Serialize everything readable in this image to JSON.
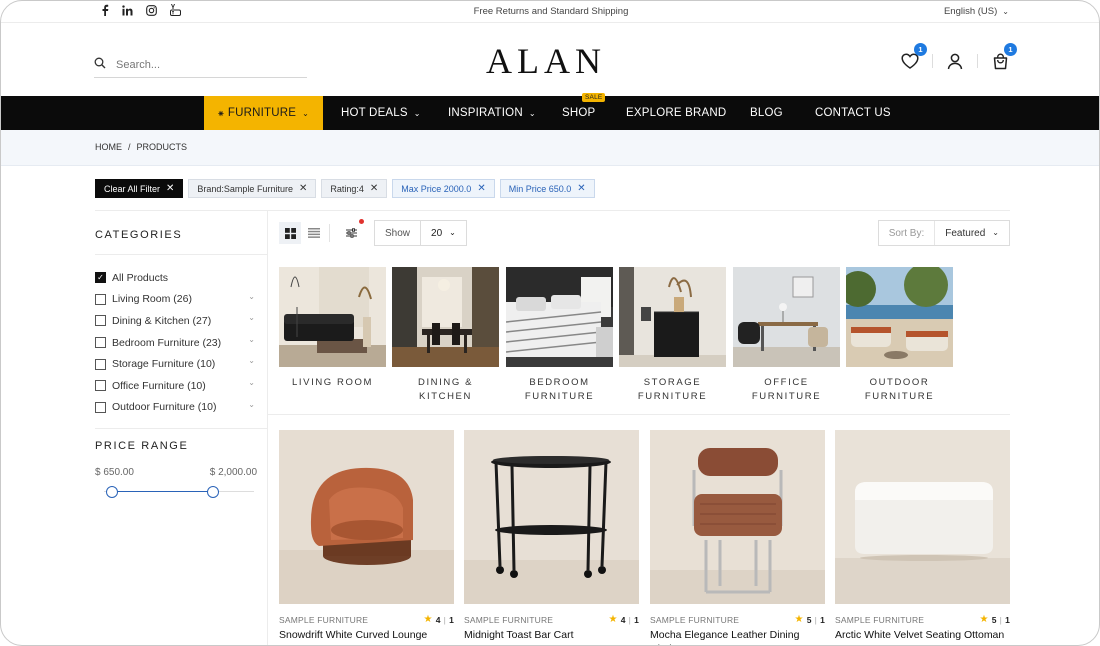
{
  "topbar": {
    "promo": "Free Returns and Standard Shipping",
    "language": "English (US)",
    "socials": [
      "facebook-icon",
      "linkedin-icon",
      "instagram-icon",
      "youtube-icon"
    ]
  },
  "header": {
    "logo": "ALAN",
    "search_placeholder": "Search...",
    "wishlist_count": "1",
    "cart_count": "1"
  },
  "nav": {
    "items": [
      {
        "label": "FURNITURE",
        "icon": "snowflake-icon",
        "dropdown": true,
        "active": true
      },
      {
        "label": "HOT DEALS",
        "dropdown": true
      },
      {
        "label": "INSPIRATION",
        "dropdown": true
      },
      {
        "label": "SHOP",
        "tag": "SALE"
      },
      {
        "label": "EXPLORE BRAND"
      },
      {
        "label": "BLOG"
      },
      {
        "label": "CONTACT US"
      }
    ]
  },
  "breadcrumb": {
    "home": "HOME",
    "sep": "/",
    "current": "PRODUCTS"
  },
  "filters": {
    "clear_label": "Clear All Filter",
    "chips": [
      "Brand:Sample Furniture",
      "Rating:4",
      "Max Price 2000.0",
      "Min Price 650.0"
    ]
  },
  "sidebar": {
    "categories_title": "CATEGORIES",
    "categories": [
      {
        "label": "All Products",
        "checked": true
      },
      {
        "label": "Living Room (26)"
      },
      {
        "label": "Dining & Kitchen (27)"
      },
      {
        "label": "Bedroom Furniture (23)"
      },
      {
        "label": "Storage Furniture (10)"
      },
      {
        "label": "Office Furniture (10)"
      },
      {
        "label": "Outdoor Furniture (10)"
      }
    ],
    "price_title": "PRICE RANGE",
    "price_min": "$ 650.00",
    "price_max": "$ 2,000.00"
  },
  "toolbar": {
    "show_label": "Show",
    "show_value": "20",
    "sort_label": "Sort By:",
    "sort_value": "Featured"
  },
  "category_tiles": [
    "LIVING ROOM",
    "DINING & KITCHEN",
    "BEDROOM FURNITURE",
    "STORAGE FURNITURE",
    "OFFICE FURNITURE",
    "OUTDOOR FURNITURE"
  ],
  "products": [
    {
      "brand": "SAMPLE FURNITURE",
      "rating": "4",
      "reviews": "1",
      "name": "Snowdrift White Curved Lounge"
    },
    {
      "brand": "SAMPLE FURNITURE",
      "rating": "4",
      "reviews": "1",
      "name": "Midnight Toast Bar Cart"
    },
    {
      "brand": "SAMPLE FURNITURE",
      "rating": "5",
      "reviews": "1",
      "name": "Mocha Elegance Leather Dining Chair"
    },
    {
      "brand": "SAMPLE FURNITURE",
      "rating": "5",
      "reviews": "1",
      "name": "Arctic White Velvet Seating Ottoman"
    }
  ]
}
